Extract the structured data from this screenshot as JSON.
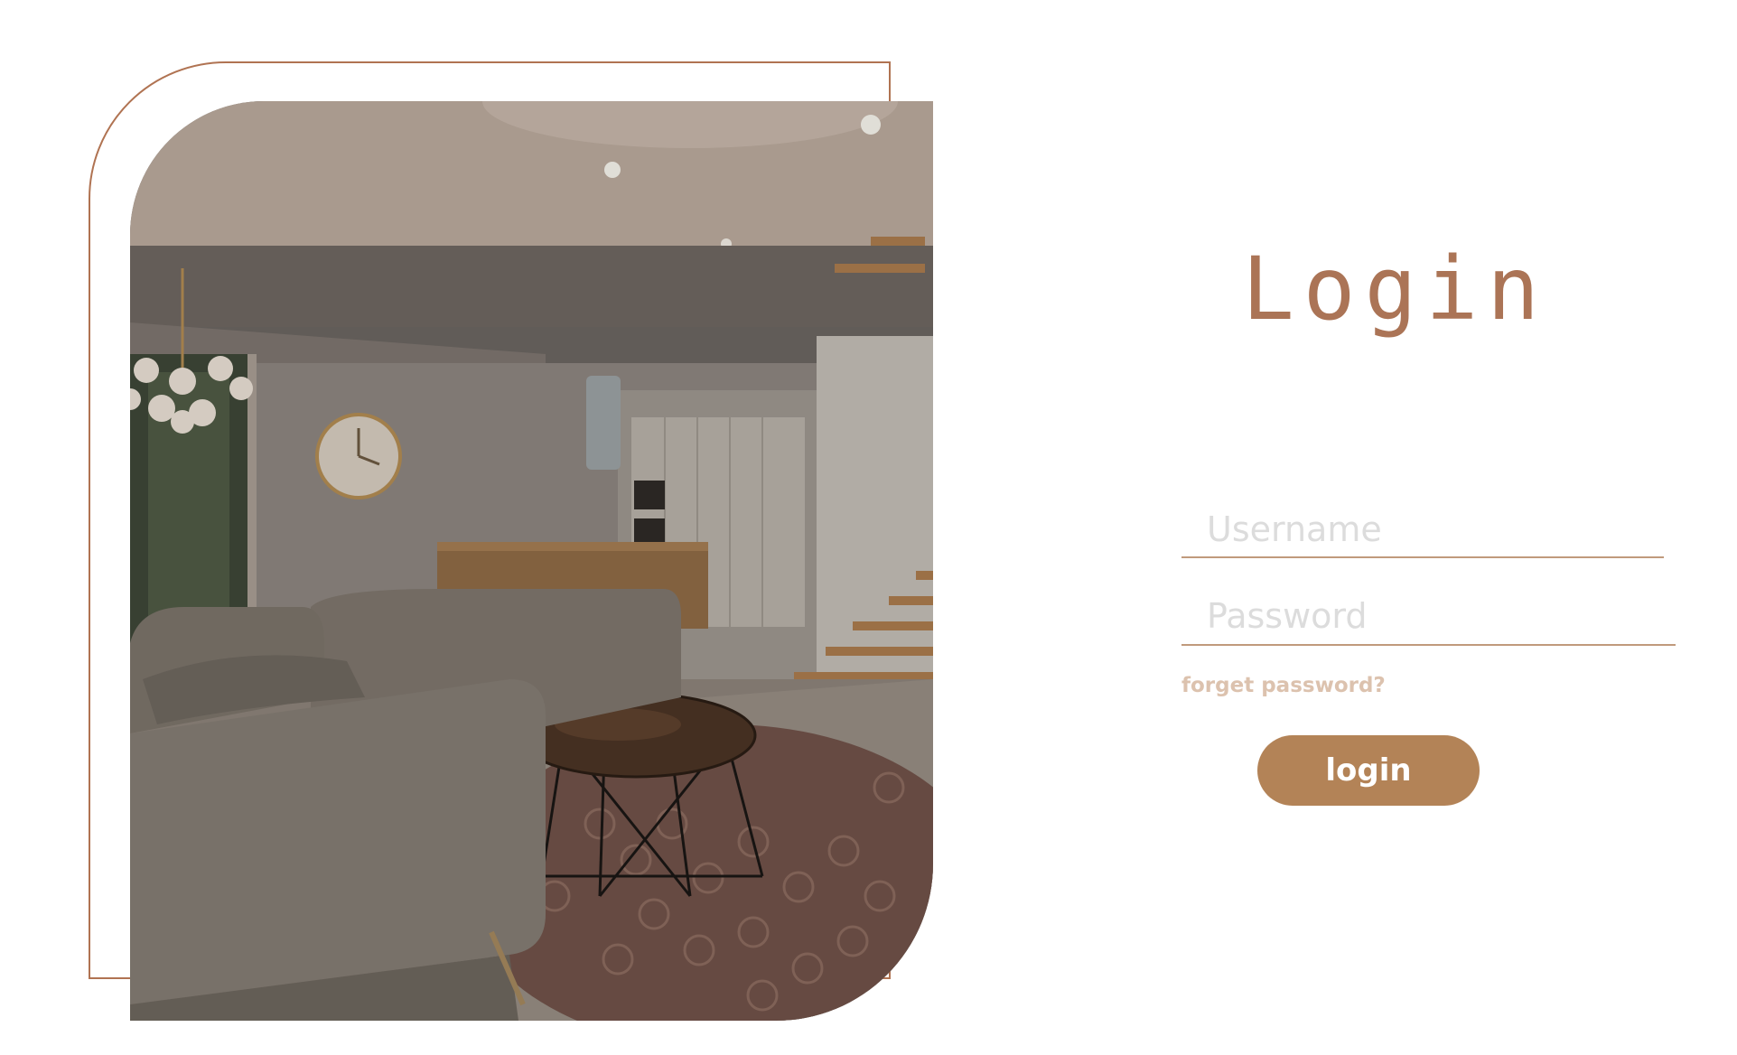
{
  "login": {
    "title": "Login",
    "username_placeholder": "Username",
    "password_placeholder": "Password",
    "forgot_label": "forget password?",
    "button_label": "login"
  },
  "theme": {
    "accent": "#b38357",
    "title_color": "#ab7456",
    "outline_color": "#b07352",
    "link_color": "#dcc2ae"
  },
  "image": {
    "subject": "modern living room interior with sofa, round glass coffee table, rug, wall clock and staircase"
  }
}
